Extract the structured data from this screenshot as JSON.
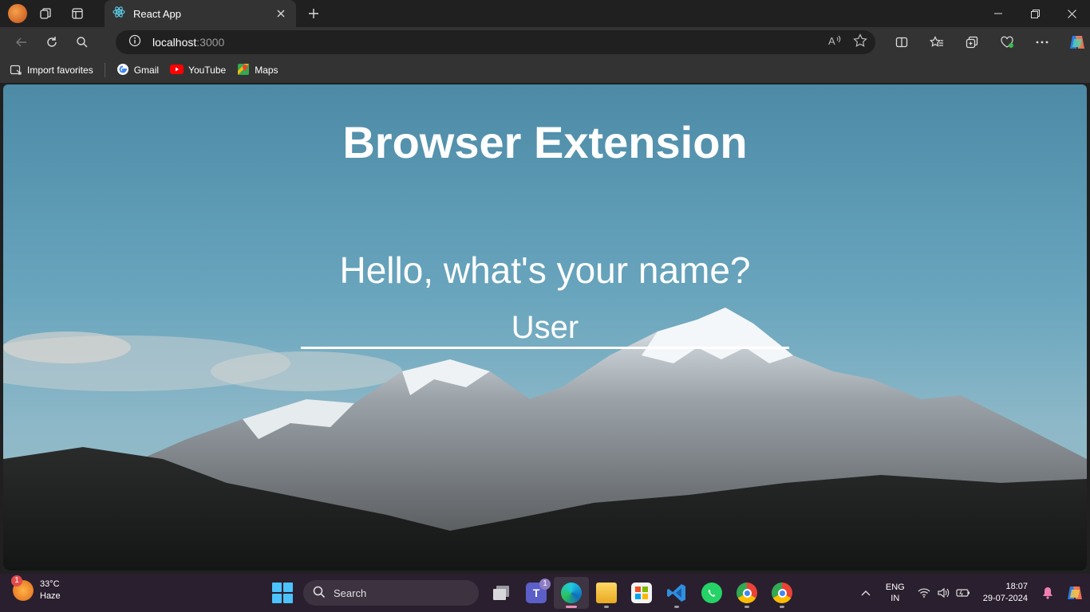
{
  "browser": {
    "tab": {
      "title": "React App"
    },
    "address": {
      "host": "localhost",
      "port": ":3000"
    }
  },
  "favorites": [
    {
      "label": "Import favorites",
      "icon": "import-favorites-icon"
    },
    {
      "label": "Gmail",
      "icon": "google-icon"
    },
    {
      "label": "YouTube",
      "icon": "youtube-icon"
    },
    {
      "label": "Maps",
      "icon": "maps-icon"
    }
  ],
  "page": {
    "title": "Browser Extension",
    "question": "Hello, what's your name?",
    "name_value": "User"
  },
  "taskbar": {
    "weather": {
      "temp": "33°C",
      "condition": "Haze",
      "badge": "1"
    },
    "search_label": "Search",
    "teams_badge": "1",
    "language": {
      "line1": "ENG",
      "line2": "IN"
    },
    "clock": {
      "time": "18:07",
      "date": "29-07-2024"
    }
  },
  "colors": {
    "chrome_dark": "#202020",
    "chrome_mid": "#333333",
    "taskbar": "#2a1f2e",
    "accent": "#4cc2ff"
  }
}
